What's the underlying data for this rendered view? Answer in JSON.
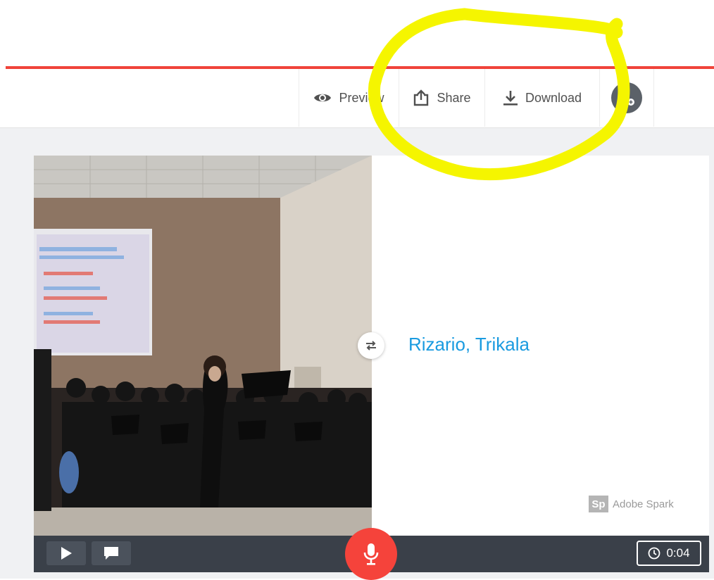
{
  "toolbar": {
    "preview_label": "Preview",
    "share_label": "Share",
    "download_label": "Download"
  },
  "slide": {
    "title": "Rizario, Trikala"
  },
  "brand": {
    "logo_text": "Sp",
    "name": "Adobe Spark"
  },
  "player": {
    "duration": "0:04"
  },
  "colors": {
    "accent_red": "#f0433a",
    "link_blue": "#1a9be0",
    "highlight_yellow": "#f5f500",
    "control_bar": "#3a4049"
  },
  "icons": [
    "eye-icon",
    "share-icon",
    "download-icon",
    "add-user-icon",
    "swap-icon",
    "play-icon",
    "caption-icon",
    "microphone-icon",
    "clock-icon"
  ]
}
